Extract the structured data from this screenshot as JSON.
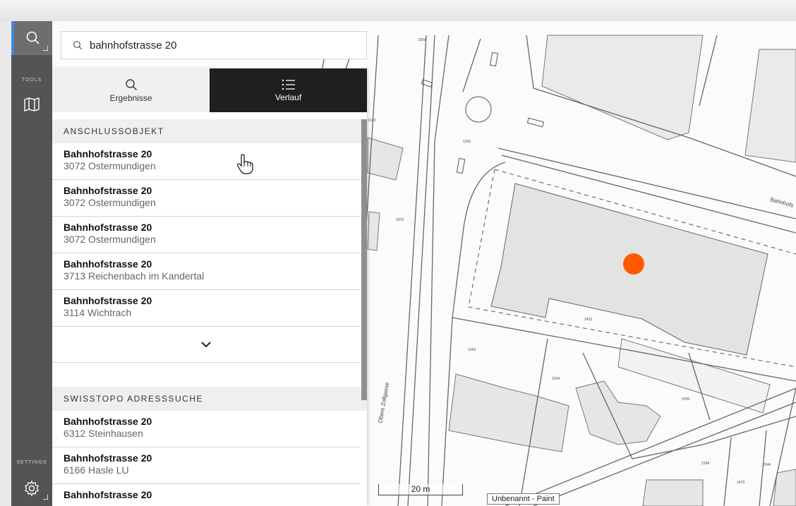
{
  "search": {
    "value": "bahnhofstrasse 20"
  },
  "sidebar": {
    "tools_label": "TOOLS",
    "settings_label": "SETTINGS"
  },
  "tabs": [
    {
      "label": "Ergebnisse",
      "icon": "search-icon"
    },
    {
      "label": "Verlauf",
      "icon": "list-icon"
    }
  ],
  "sections": [
    {
      "title": "ANSCHLUSSOBJEKT",
      "results": [
        {
          "street": "Bahnhofstrasse 20",
          "city": "3072 Ostermundigen"
        },
        {
          "street": "Bahnhofstrasse 20",
          "city": "3072 Ostermundigen"
        },
        {
          "street": "Bahnhofstrasse 20",
          "city": "3072 Ostermundigen"
        },
        {
          "street": "Bahnhofstrasse 20",
          "city": "3713 Reichenbach im Kandertal"
        },
        {
          "street": "Bahnhofstrasse 20",
          "city": "3114 Wichtrach"
        }
      ]
    },
    {
      "title": "SWISSTOPO ADRESSSUCHE",
      "results": [
        {
          "street": "Bahnhofstrasse 20",
          "city": "6312 Steinhausen"
        },
        {
          "street": "Bahnhofstrasse 20",
          "city": "6166 Hasle LU"
        },
        {
          "street": "Bahnhofstrasse 20",
          "city": ""
        }
      ]
    }
  ],
  "map": {
    "scale_label": "20 m",
    "street_labels": [
      "Obere Zollgasse",
      "Bahnhofs"
    ],
    "parcel_numbers": [
      "1509",
      "2133",
      "1342",
      "2475",
      "1432",
      "1263",
      "3764",
      "3765",
      "2194",
      "2344",
      "1479"
    ],
    "marker_color": "#ff5a00"
  },
  "tooltip": {
    "text": "Unbenannt - Paint"
  },
  "colors": {
    "accent": "#3d8ee0",
    "active_tab": "#1f1f1f"
  }
}
